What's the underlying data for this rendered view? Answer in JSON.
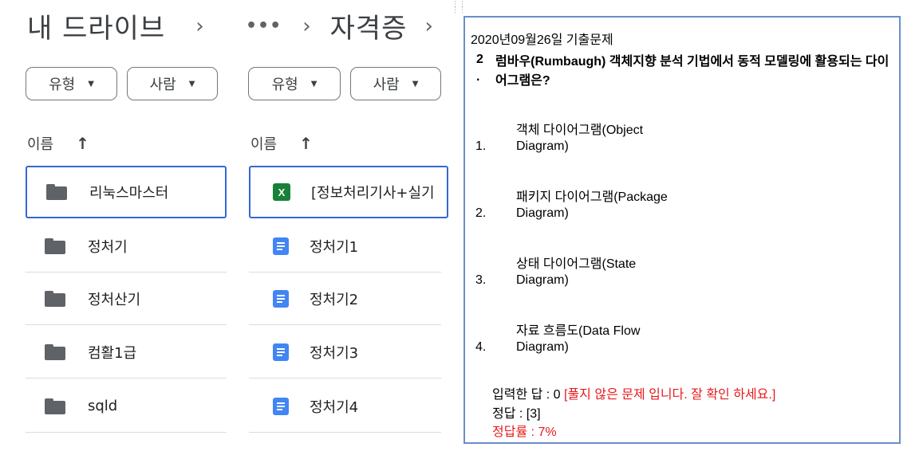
{
  "left_pane": {
    "breadcrumb_root": "내 드라이브",
    "breadcrumb_sep": "›",
    "filters": {
      "type": "유형",
      "people": "사람"
    },
    "sort": {
      "label": "이름",
      "arrow": "↑"
    },
    "rows": [
      {
        "name": "리눅스마스터",
        "kind": "folder"
      },
      {
        "name": "정처기",
        "kind": "folder"
      },
      {
        "name": "정처산기",
        "kind": "folder"
      },
      {
        "name": "컴활1급",
        "kind": "folder"
      },
      {
        "name": "sqld",
        "kind": "folder"
      }
    ]
  },
  "mid_pane": {
    "breadcrumb_more": "•••",
    "breadcrumb_sep": "›",
    "breadcrumb_current": "자격증",
    "breadcrumb_sep2": "›",
    "filters": {
      "type": "유형",
      "people": "사람"
    },
    "sort": {
      "label": "이름",
      "arrow": "↑"
    },
    "rows": [
      {
        "name": "[정보처리기사+실기",
        "kind": "sheet",
        "icon_glyph": "X"
      },
      {
        "name": "정처기1",
        "kind": "doc"
      },
      {
        "name": "정처기2",
        "kind": "doc"
      },
      {
        "name": "정처기3",
        "kind": "doc"
      },
      {
        "name": "정처기4",
        "kind": "doc"
      }
    ]
  },
  "quiz": {
    "title": "2020년09월26일 기출문제",
    "question_number": "2",
    "question_dot": ".",
    "question_text": "럼바우(Rumbaugh) 객체지향 분석 기법에서 동적 모델링에 활용되는 다이어그램은?",
    "options": [
      {
        "num": "1.",
        "line1": "객체 다이어그램(Object",
        "line2": "Diagram)"
      },
      {
        "num": "2.",
        "line1": "패키지 다이어그램(Package",
        "line2": "Diagram)"
      },
      {
        "num": "3.",
        "line1": "상태 다이어그램(State",
        "line2": "Diagram)"
      },
      {
        "num": "4.",
        "line1": "자료 흐름도(Data Flow",
        "line2": "Diagram)"
      }
    ],
    "entered_answer_label": "입력한 답 : 0",
    "entered_answer_warning": "[풀지 않은 문제 입니다. 잘 확인 하세요.]",
    "correct_answer": "정답 : [3]",
    "correct_rate": "정답률 : 7%"
  },
  "colors": {
    "selected_border": "#3367d6",
    "doc_blue": "#4285f4",
    "sheet_green": "#188038",
    "panel_border": "#6a8ec8",
    "warning_red": "#e8191b"
  }
}
